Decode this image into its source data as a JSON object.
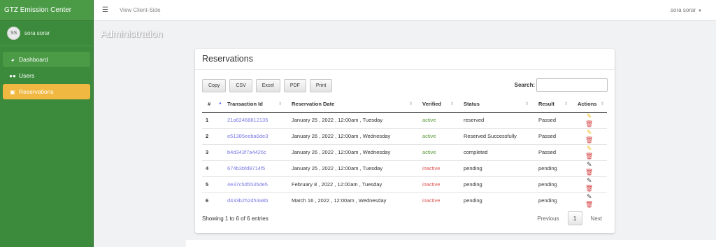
{
  "sidebar": {
    "brand": "GTZ Emission Center",
    "user_initials": "SS",
    "user_name": "sora sorar",
    "items": [
      {
        "label": "Dashboard"
      },
      {
        "label": "Users"
      },
      {
        "label": "Reservations"
      }
    ]
  },
  "topbar": {
    "menu_icon": "☰",
    "view_client": "View Client-Side",
    "user": "sora sorar"
  },
  "page_title": "Administration",
  "card": {
    "title": "Reservations",
    "buttons": [
      "Copy",
      "CSV",
      "Excel",
      "PDF",
      "Print"
    ],
    "search_label": "Search:",
    "search_value": "",
    "columns": [
      "#",
      "Transaction Id",
      "Reservation Date",
      "Verified",
      "Status",
      "Result",
      "Actions"
    ],
    "rows": [
      {
        "num": "1",
        "tid": "21a62468812135",
        "date": "January 25 , 2022 , 12:00am , Tuesday",
        "verified": "active",
        "status": "reserved",
        "result": "Passed"
      },
      {
        "num": "2",
        "tid": "e51385eeba6de3",
        "date": "January 26 , 2022 , 12:00am , Wednesday",
        "verified": "active",
        "status": "Reserved Successfully",
        "result": "Passed"
      },
      {
        "num": "3",
        "tid": "b4d343f7a4426c",
        "date": "January 26 , 2022 , 12:00am , Wednesday",
        "verified": "active",
        "status": "completed",
        "result": "Passed"
      },
      {
        "num": "4",
        "tid": "674b3bfd9714f5",
        "date": "January 25 , 2022 , 12:00am , Tuesday",
        "verified": "inactive",
        "status": "pending",
        "result": "pending"
      },
      {
        "num": "5",
        "tid": "4e37c5d5535de5",
        "date": "February 8 , 2022 , 12:00am , Tuesday",
        "verified": "inactive",
        "status": "pending",
        "result": "pending"
      },
      {
        "num": "6",
        "tid": "d433b252d53a8b",
        "date": "March 16 , 2022 , 12:00am , Wednesday",
        "verified": "inactive",
        "status": "pending",
        "result": "pending"
      }
    ],
    "info": "Showing 1 to 6 of 6 entries",
    "pager": {
      "prev": "Previous",
      "current": "1",
      "next": "Next"
    }
  },
  "colors": {
    "sidebar": "#3c8b3c",
    "active_item": "#f0b840",
    "link": "#7b7be6",
    "active_text": "#5b9a3a",
    "inactive_text": "#d9534f"
  }
}
